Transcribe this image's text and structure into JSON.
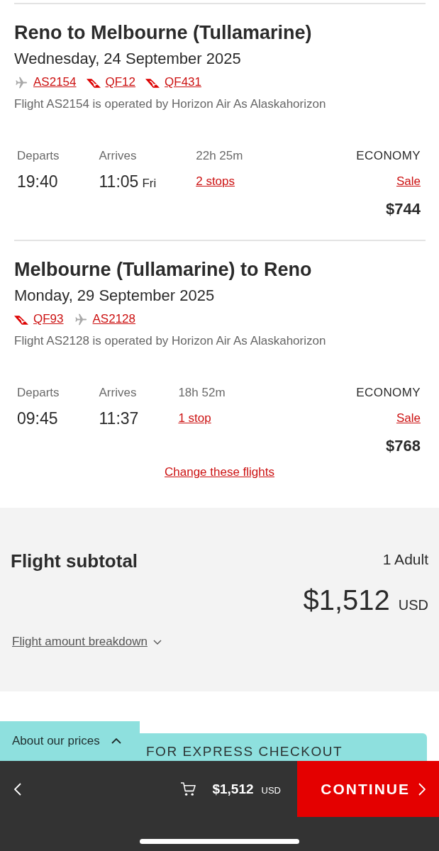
{
  "flights": [
    {
      "route": "Reno to Melbourne (Tullamarine)",
      "date": "Wednesday, 24 September 2025",
      "segments": [
        {
          "kind": "plane",
          "code": "AS2154"
        },
        {
          "kind": "tail",
          "code": "QF12"
        },
        {
          "kind": "tail",
          "code": "QF431"
        }
      ],
      "operated_note": "Flight AS2154 is operated by Horizon Air As Alaskahorizon",
      "departs_label": "Departs",
      "depart_time": "19:40",
      "arrives_label": "Arrives",
      "arrive_time": "11:05",
      "arrive_day": "Fri",
      "duration": "22h 25m",
      "stops": "2 stops",
      "cabin": "ECONOMY",
      "fare": "Sale",
      "price": "$744"
    },
    {
      "route": "Melbourne (Tullamarine) to Reno",
      "date": "Monday, 29 September 2025",
      "segments": [
        {
          "kind": "tail",
          "code": "QF93"
        },
        {
          "kind": "plane",
          "code": "AS2128"
        }
      ],
      "operated_note": "Flight AS2128 is operated by Horizon Air As Alaskahorizon",
      "departs_label": "Departs",
      "depart_time": "09:45",
      "arrives_label": "Arrives",
      "arrive_time": "11:37",
      "duration": "18h 52m",
      "stops": "1 stop",
      "cabin": "ECONOMY",
      "fare": "Sale",
      "price": "$768"
    }
  ],
  "change_link": "Change these flights",
  "subtotal": {
    "title": "Flight subtotal",
    "passengers": "1 Adult",
    "amount": "$1,512",
    "currency": "USD",
    "breakdown": "Flight amount breakdown"
  },
  "about_prices": {
    "label": "About our prices"
  },
  "banner": {
    "text": "FOR EXPRESS CHECKOUT"
  },
  "bottom_bar": {
    "amount": "$1,512",
    "currency": "USD",
    "continue": "CONTINUE"
  }
}
